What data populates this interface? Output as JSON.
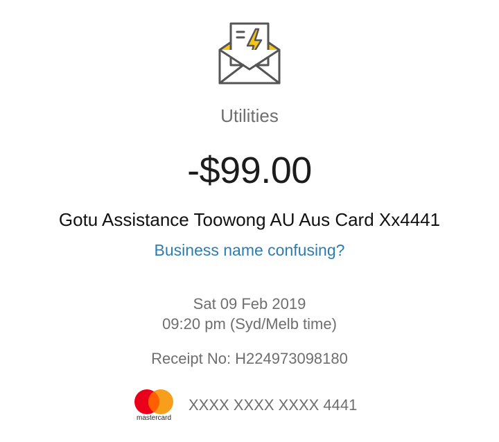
{
  "transaction": {
    "category_icon": "envelope-bill-lightning-icon",
    "category": "Utilities",
    "amount": "-$99.00",
    "merchant": "Gotu Assistance Toowong AU Aus Card Xx4441",
    "help_link": "Business name confusing?",
    "date": "Sat 09 Feb 2019",
    "time": "09:20 pm (Syd/Melb time)",
    "receipt": "Receipt No: H224973098180"
  },
  "card": {
    "brand_icon": "mastercard-logo-icon",
    "brand_text": "mastercard",
    "number": "XXXX XXXX XXXX 4441"
  },
  "colors": {
    "accent": "#2b7cb0",
    "icon_yellow": "#f5c518",
    "icon_outline": "#555555",
    "muted_text": "#6e6e6e",
    "mc_red": "#eb001b",
    "mc_orange": "#f79e1b",
    "mc_overlap": "#ff5f00"
  }
}
